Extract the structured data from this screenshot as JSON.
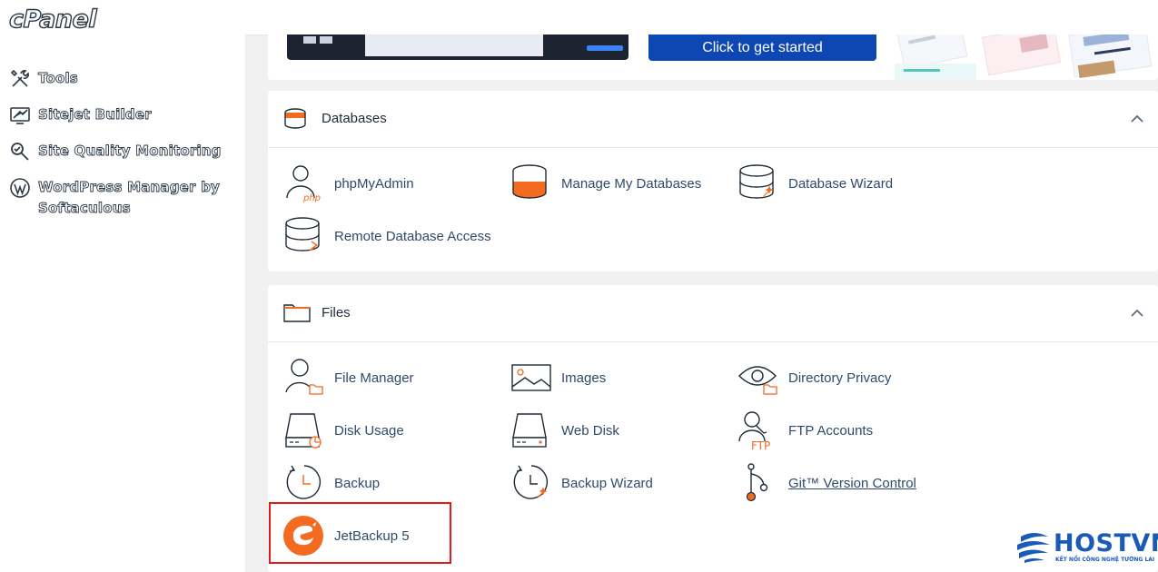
{
  "brand": {
    "logo_text": "cPanel"
  },
  "sidebar": {
    "items": [
      {
        "label": "Tools",
        "icon": "tools-icon"
      },
      {
        "label": "Sitejet Builder",
        "icon": "sitejet-icon"
      },
      {
        "label": "Site Quality Monitoring",
        "icon": "site-quality-icon"
      },
      {
        "label": "WordPress Manager by",
        "label2": "Softaculous",
        "icon": "wordpress-icon"
      }
    ]
  },
  "promo": {
    "button_label": "Click to get started"
  },
  "databases": {
    "title": "Databases",
    "items": [
      {
        "label": "phpMyAdmin",
        "icon": "phpmyadmin-icon"
      },
      {
        "label": "Manage My Databases",
        "icon": "manage-databases-icon"
      },
      {
        "label": "Database Wizard",
        "icon": "database-wizard-icon"
      },
      {
        "label": "Remote Database Access",
        "icon": "remote-database-icon"
      }
    ]
  },
  "files": {
    "title": "Files",
    "items": [
      {
        "label": "File Manager",
        "icon": "file-manager-icon"
      },
      {
        "label": "Images",
        "icon": "images-icon"
      },
      {
        "label": "Directory Privacy",
        "icon": "directory-privacy-icon"
      },
      {
        "label": "Disk Usage",
        "icon": "disk-usage-icon"
      },
      {
        "label": "Web Disk",
        "icon": "web-disk-icon"
      },
      {
        "label": "FTP Accounts",
        "icon": "ftp-accounts-icon"
      },
      {
        "label": "Backup",
        "icon": "backup-icon"
      },
      {
        "label": "Backup Wizard",
        "icon": "backup-wizard-icon"
      },
      {
        "label": "Git™ Version Control",
        "icon": "git-icon"
      },
      {
        "label": "JetBackup 5",
        "icon": "jetbackup-icon"
      }
    ]
  },
  "watermark": {
    "name": "HOSTVN",
    "tagline": "KẾT NỐI CÔNG NGHỆ TƯƠNG LAI"
  },
  "colors": {
    "accent_orange": "#f26b21",
    "link_blue": "#2f4a6b",
    "promo_blue": "#0d47b3",
    "highlight_red": "#e41a1a"
  }
}
